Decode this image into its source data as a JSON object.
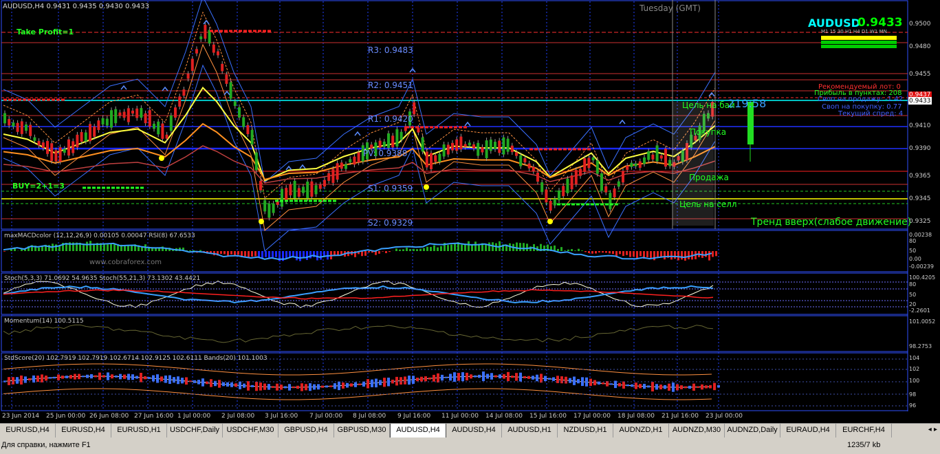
{
  "window": {
    "symbol_info": "AUDUSD,H4  0.9431 0.9435 0.9430 0.9433",
    "ticker": "AUDUSD",
    "price": "0.9433",
    "time_label": "Tuesday (GMT)",
    "timeframes": "M1 15 30 H1 H4 D1 W1 MN"
  },
  "labels": {
    "take_profit": "Take Profit=1",
    "buy_signal": "BUY=2+1=3",
    "trend": "Тренд вверх(слабое движение)",
    "target_buy": "Цель на бай",
    "target_sell": "Цель на селл",
    "buy": "Покупка",
    "sell": "Продажа",
    "spread_timer": "219:58",
    "watermark": "www.cobraforex.com"
  },
  "pivots": {
    "r3": "R3:  0.9483",
    "r2": "R2:  0.9451",
    "r1": "R1:  0.9420",
    "pv": "PV:  0.9388",
    "s1": "S1:  0.9359",
    "s2": "S2:  0.9329"
  },
  "info_panel": {
    "lot": "Рекомендуемый лот: 0",
    "profit": "Прибыль в пунктах: 208",
    "swap_sell": "Своп на продажу: -1.42",
    "swap_buy": "Своп на покупку: 0.77",
    "spread": "Текущий спред: 4"
  },
  "price_axis": [
    "0.9500",
    "0.9480",
    "0.9455",
    "0.9433",
    "0.9410",
    "0.9390",
    "0.9365",
    "0.9345",
    "0.9325"
  ],
  "price_tags": {
    "red": "0.9437",
    "cyan": "0.9433"
  },
  "indicators": {
    "macd": "maxMACDcolor (12,12,26,9) 0.00105 0.00047  RSI(8) 67.6533",
    "macd_axis": [
      "0.00238",
      "80",
      "50",
      "0.00",
      "-0.00239"
    ],
    "stoch": "Stoch(5,3,3) 71.0692 54.9635  Stoch(55,21,3) 73.1302 43.4421",
    "stoch_axis": [
      "100.4205",
      "80",
      "50",
      "20",
      "-2.2601"
    ],
    "momentum": "Momentum(14) 100.5115",
    "momentum_axis": [
      "101.0052",
      "98.2753"
    ],
    "stdscore": "StdScore(20) 102.7919 102.7919 102.6714 102.9125 102.6111  Bands(20) 101.1003",
    "stdscore_axis": [
      "104",
      "102",
      "100",
      "98",
      "96"
    ]
  },
  "time_axis": [
    "23 Jun 2014",
    "25 Jun 00:00",
    "26 Jun 08:00",
    "27 Jun 16:00",
    "1 Jul 00:00",
    "2 Jul 08:00",
    "3 Jul 16:00",
    "7 Jul 00:00",
    "8 Jul 08:00",
    "9 Jul 16:00",
    "11 Jul 00:00",
    "14 Jul 08:00",
    "15 Jul 16:00",
    "17 Jul 00:00",
    "18 Jul 08:00",
    "21 Jul 16:00",
    "23 Jul 00:00"
  ],
  "tabs": [
    "EURUSD,H4",
    "EURUSD,H4",
    "EURUSD,H1",
    "USDCHF,Daily",
    "USDCHF,M30",
    "GBPUSD,H4",
    "GBPUSD,M30",
    "AUDUSD,H4",
    "AUDUSD,H4",
    "AUDUSD,H1",
    "NZDUSD,H1",
    "AUDNZD,H1",
    "AUDNZD,M30",
    "AUDNZD,Daily",
    "EURAUD,H4",
    "EURCHF,H4"
  ],
  "active_tab": 7,
  "status": {
    "help": "Для справки, нажмите F1",
    "traffic": "1235/7 kb"
  },
  "colors": {
    "bull": "#22cc22",
    "bear": "#ff2020",
    "grid": "#1e40ff",
    "ticker": "#00ffff",
    "price": "#00ff00"
  }
}
